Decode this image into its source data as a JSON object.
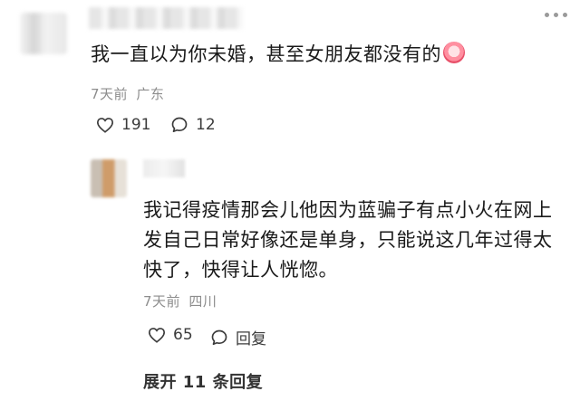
{
  "top_comment": {
    "text": "我一直以为你未婚，甚至女朋友都没有的",
    "emoji_icon": "crying-clown-emoji",
    "time": "7天前",
    "location": "广东",
    "likes": "191",
    "replies": "12"
  },
  "reply_comment": {
    "text_line1": "我记得疫情那会儿他因为蓝骗子有点小火在网上",
    "text_line2": "发自己日常好像还是单身，只能说这几年过得太",
    "text_line3": "快了，快得让人恍惚。",
    "time": "7天前",
    "location": "四川",
    "likes": "65",
    "reply_label": "回复"
  },
  "expand_replies": "展开 11 条回复",
  "colors": {
    "text": "#1a1a1a",
    "meta": "#8d8d8d",
    "icon": "#3b3b3b"
  }
}
